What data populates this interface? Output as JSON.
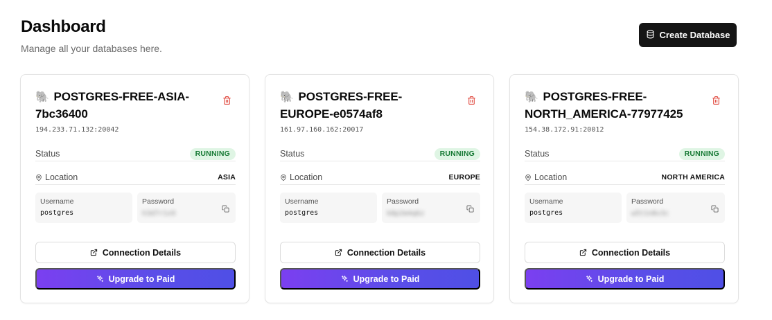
{
  "header": {
    "title": "Dashboard",
    "subtitle": "Manage all your databases here.",
    "create_button_label": "Create Database",
    "create_button_icon": "database-icon"
  },
  "colors": {
    "primary_button": "#151515",
    "status_badge_bg": "#dff5e4",
    "status_badge_text": "#177a35",
    "delete_icon": "#e0483e",
    "upgrade_gradient_start": "#7b3ff0",
    "upgrade_gradient_end": "#4f4fe6"
  },
  "databases": [
    {
      "emoji": "🐘",
      "name": "POSTGRES-FREE-ASIA-7bc36400",
      "address": "194.233.71.132:20042",
      "status_label": "Status",
      "status": "RUNNING",
      "location_label": "Location",
      "location": "ASIA",
      "username_label": "Username",
      "username": "postgres",
      "password_label": "Password",
      "password_masked": "h3d7r1x9",
      "connection_button": "Connection Details",
      "upgrade_button": "Upgrade to Paid"
    },
    {
      "emoji": "🐘",
      "name": "POSTGRES-FREE-EUROPE-e0574af8",
      "address": "161.97.160.162:20017",
      "status_label": "Status",
      "status": "RUNNING",
      "location_label": "Location",
      "location": "EUROPE",
      "username_label": "Username",
      "username": "postgres",
      "password_label": "Password",
      "password_masked": "k8p2m4q6z",
      "connection_button": "Connection Details",
      "upgrade_button": "Upgrade to Paid"
    },
    {
      "emoji": "🐘",
      "name": "POSTGRES-FREE-NORTH_AMERICA-77977425",
      "address": "154.38.172.91:20012",
      "status_label": "Status",
      "status": "RUNNING",
      "location_label": "Location",
      "location": "NORTH AMERICA",
      "username_label": "Username",
      "username": "postgres",
      "password_label": "Password",
      "password_masked": "w5t1n8v3c",
      "connection_button": "Connection Details",
      "upgrade_button": "Upgrade to Paid"
    }
  ]
}
